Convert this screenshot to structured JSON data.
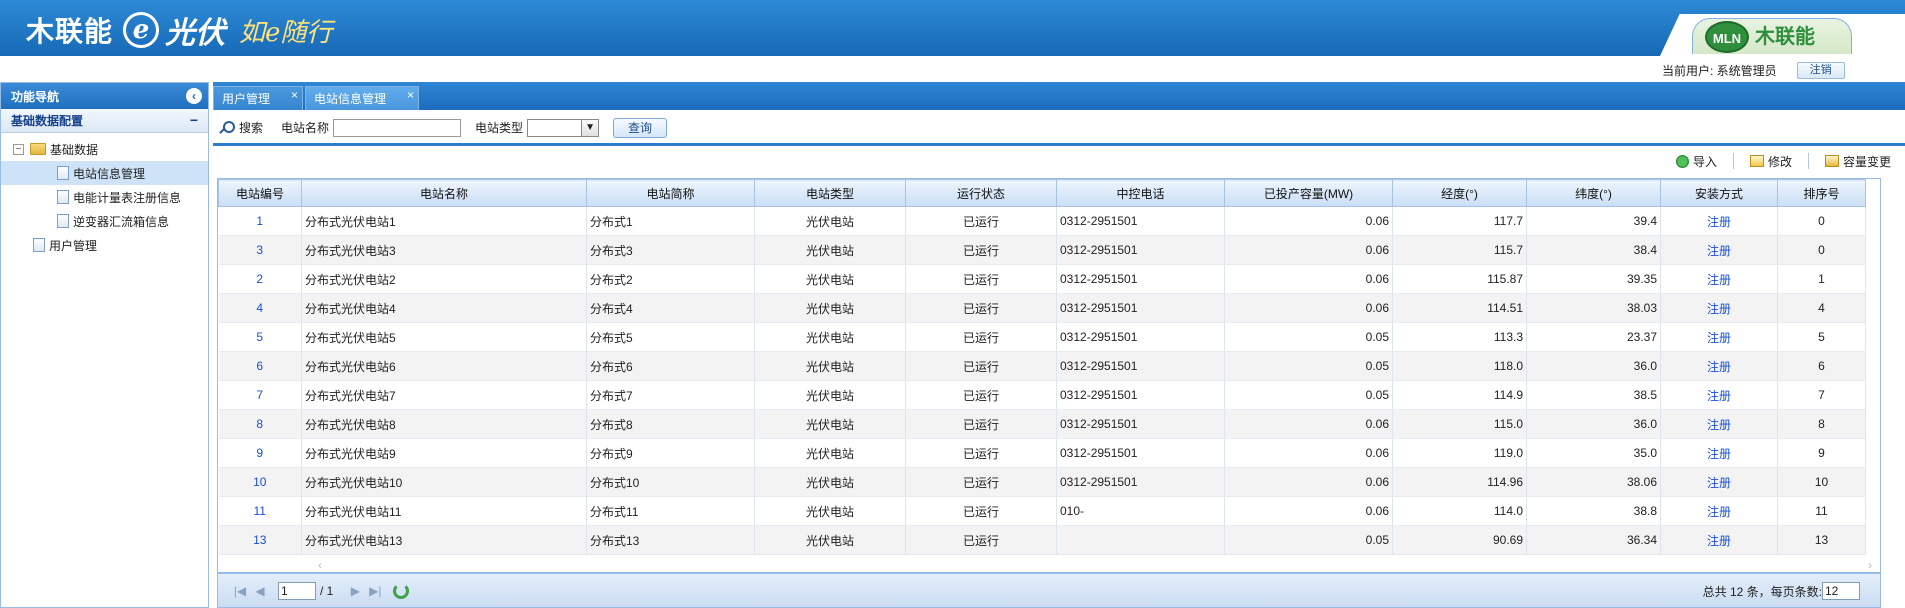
{
  "header": {
    "brand": "木联能",
    "e_mark": "e",
    "pv": "光伏",
    "slogan": "如e随行",
    "right_logo_mark": "MLN",
    "right_logo_text": "木联能",
    "current_user_label": "当前用户: 系统管理员",
    "logout_label": "注销"
  },
  "sidebar": {
    "title": "功能导航",
    "section": "基础数据配置",
    "tree": {
      "root": "基础数据",
      "children": [
        "电站信息管理",
        "电能计量表注册信息",
        "逆变器汇流箱信息"
      ],
      "selected": "电站信息管理",
      "other": "用户管理"
    }
  },
  "tabs": [
    {
      "label": "用户管理",
      "active": false
    },
    {
      "label": "电站信息管理",
      "active": true
    }
  ],
  "toolbar": {
    "search_label": "搜索",
    "name_label": "电站名称",
    "name_value": "",
    "type_label": "电站类型",
    "type_value": "",
    "query_label": "查询"
  },
  "actions": [
    {
      "label": "导入",
      "icon": "import-icon"
    },
    {
      "label": "修改",
      "icon": "edit-icon"
    },
    {
      "label": "容量变更",
      "icon": "capacity-change-icon"
    }
  ],
  "grid": {
    "columns": [
      "电站编号",
      "电站名称",
      "电站简称",
      "电站类型",
      "运行状态",
      "中控电话",
      "已投产容量(MW)",
      "经度(°)",
      "纬度(°)",
      "安装方式",
      "排序号"
    ],
    "rows": [
      [
        "1",
        "分布式光伏电站1",
        "分布式1",
        "光伏电站",
        "已运行",
        "0312-2951501",
        "0.06",
        "117.7",
        "39.4",
        "注册",
        "0"
      ],
      [
        "3",
        "分布式光伏电站3",
        "分布式3",
        "光伏电站",
        "已运行",
        "0312-2951501",
        "0.06",
        "115.7",
        "38.4",
        "注册",
        "0"
      ],
      [
        "2",
        "分布式光伏电站2",
        "分布式2",
        "光伏电站",
        "已运行",
        "0312-2951501",
        "0.06",
        "115.87",
        "39.35",
        "注册",
        "1"
      ],
      [
        "4",
        "分布式光伏电站4",
        "分布式4",
        "光伏电站",
        "已运行",
        "0312-2951501",
        "0.06",
        "114.51",
        "38.03",
        "注册",
        "4"
      ],
      [
        "5",
        "分布式光伏电站5",
        "分布式5",
        "光伏电站",
        "已运行",
        "0312-2951501",
        "0.05",
        "113.3",
        "23.37",
        "注册",
        "5"
      ],
      [
        "6",
        "分布式光伏电站6",
        "分布式6",
        "光伏电站",
        "已运行",
        "0312-2951501",
        "0.05",
        "118.0",
        "36.0",
        "注册",
        "6"
      ],
      [
        "7",
        "分布式光伏电站7",
        "分布式7",
        "光伏电站",
        "已运行",
        "0312-2951501",
        "0.05",
        "114.9",
        "38.5",
        "注册",
        "7"
      ],
      [
        "8",
        "分布式光伏电站8",
        "分布式8",
        "光伏电站",
        "已运行",
        "0312-2951501",
        "0.06",
        "115.0",
        "36.0",
        "注册",
        "8"
      ],
      [
        "9",
        "分布式光伏电站9",
        "分布式9",
        "光伏电站",
        "已运行",
        "0312-2951501",
        "0.06",
        "119.0",
        "35.0",
        "注册",
        "9"
      ],
      [
        "10",
        "分布式光伏电站10",
        "分布式10",
        "光伏电站",
        "已运行",
        "0312-2951501",
        "0.06",
        "114.96",
        "38.06",
        "注册",
        "10"
      ],
      [
        "11",
        "分布式光伏电站11",
        "分布式11",
        "光伏电站",
        "已运行",
        "010-",
        "0.06",
        "114.0",
        "38.8",
        "注册",
        "11"
      ],
      [
        "13",
        "分布式光伏电站13",
        "分布式13",
        "光伏电站",
        "已运行",
        "",
        "0.05",
        "90.69",
        "36.34",
        "注册",
        "13"
      ]
    ]
  },
  "pager": {
    "current_page": "1",
    "total_pages": "/ 1",
    "summary": "总共 12 条，每页条数:",
    "page_size": "12"
  },
  "colors": {
    "header_blue": "#1769b6",
    "link_blue": "#1a4fd8",
    "brand_green": "#2f8f3d"
  }
}
